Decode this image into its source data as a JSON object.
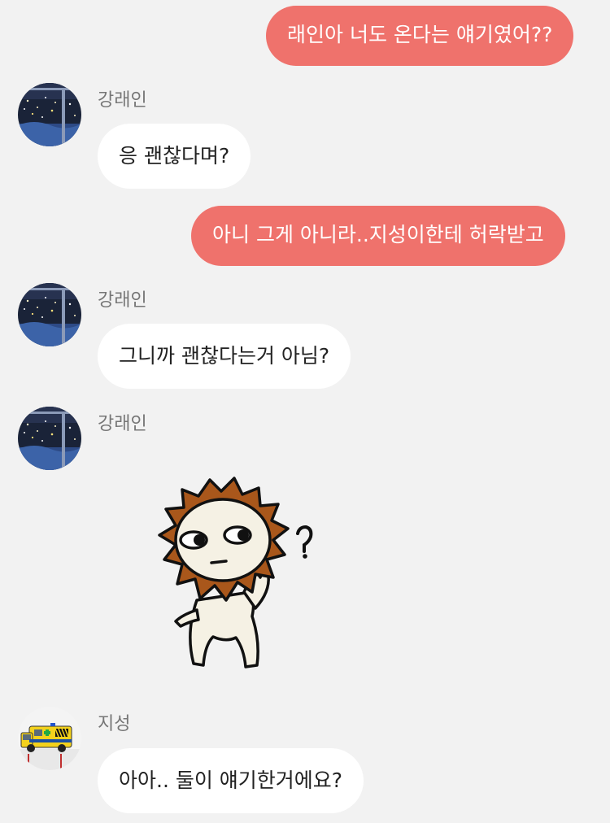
{
  "messages": [
    {
      "from": "me",
      "text": "래인아 너도 온다는 얘기였어??"
    },
    {
      "from": "강래인",
      "text": "응 괜찮다며?"
    },
    {
      "from": "me",
      "text": "아니 그게 아니라..지성이한테 허락받고"
    },
    {
      "from": "강래인",
      "text": "그니까 괜찮다는거 아님?"
    },
    {
      "from": "강래인",
      "sticker": "lion-thinking-question-sticker"
    },
    {
      "from": "지성",
      "text": "아아.. 둘이 얘기한거에요?"
    }
  ],
  "senders": {
    "rain": "강래인",
    "jisung": "지성"
  },
  "colors": {
    "background": "#f2f2f2",
    "my_bubble": "#ef726c",
    "my_text": "#ffffff",
    "other_bubble": "#ffffff",
    "other_text": "#222222",
    "sender_name": "#767676"
  },
  "icons": {
    "rain_avatar": "night-window-avatar",
    "jisung_avatar": "yellow-ambulance-avatar",
    "sticker": "lion-thinking-question-sticker"
  }
}
